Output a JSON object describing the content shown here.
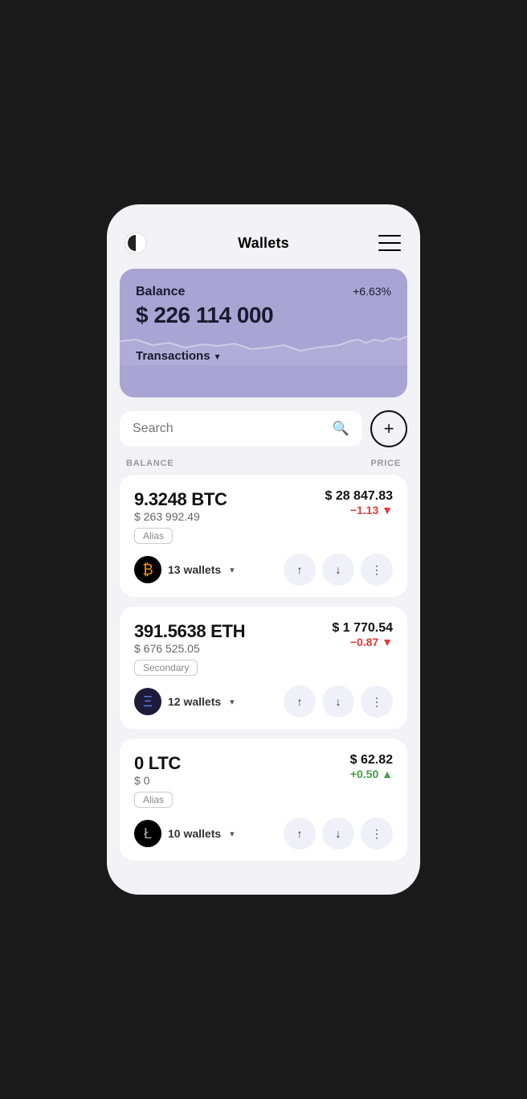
{
  "header": {
    "title": "Wallets",
    "menu_label": "menu"
  },
  "balance_card": {
    "label": "Balance",
    "amount": "$ 226 114 000",
    "percent": "+6.63%",
    "transactions_label": "Transactions"
  },
  "search": {
    "placeholder": "Search"
  },
  "columns": {
    "balance": "BALANCE",
    "price": "PRICE"
  },
  "coins": [
    {
      "balance": "9.3248 BTC",
      "fiat_balance": "$ 263 992.49",
      "alias": "Alias",
      "wallets": "13 wallets",
      "price": "$ 28 847.83",
      "change": "−1.13 ▼",
      "change_type": "negative",
      "symbol": "BTC",
      "logo_class": "btc",
      "logo_char": "₿"
    },
    {
      "balance": "391.5638 ETH",
      "fiat_balance": "$ 676 525.05",
      "alias": "Secondary",
      "wallets": "12 wallets",
      "price": "$ 1 770.54",
      "change": "−0.87 ▼",
      "change_type": "negative",
      "symbol": "ETH",
      "logo_class": "eth",
      "logo_char": "Ξ"
    },
    {
      "balance": "0 LTC",
      "fiat_balance": "$ 0",
      "alias": "Alias",
      "wallets": "10 wallets",
      "price": "$ 62.82",
      "change": "+0.50 ▲",
      "change_type": "positive",
      "symbol": "LTC",
      "logo_class": "ltc",
      "logo_char": "Ł"
    }
  ]
}
